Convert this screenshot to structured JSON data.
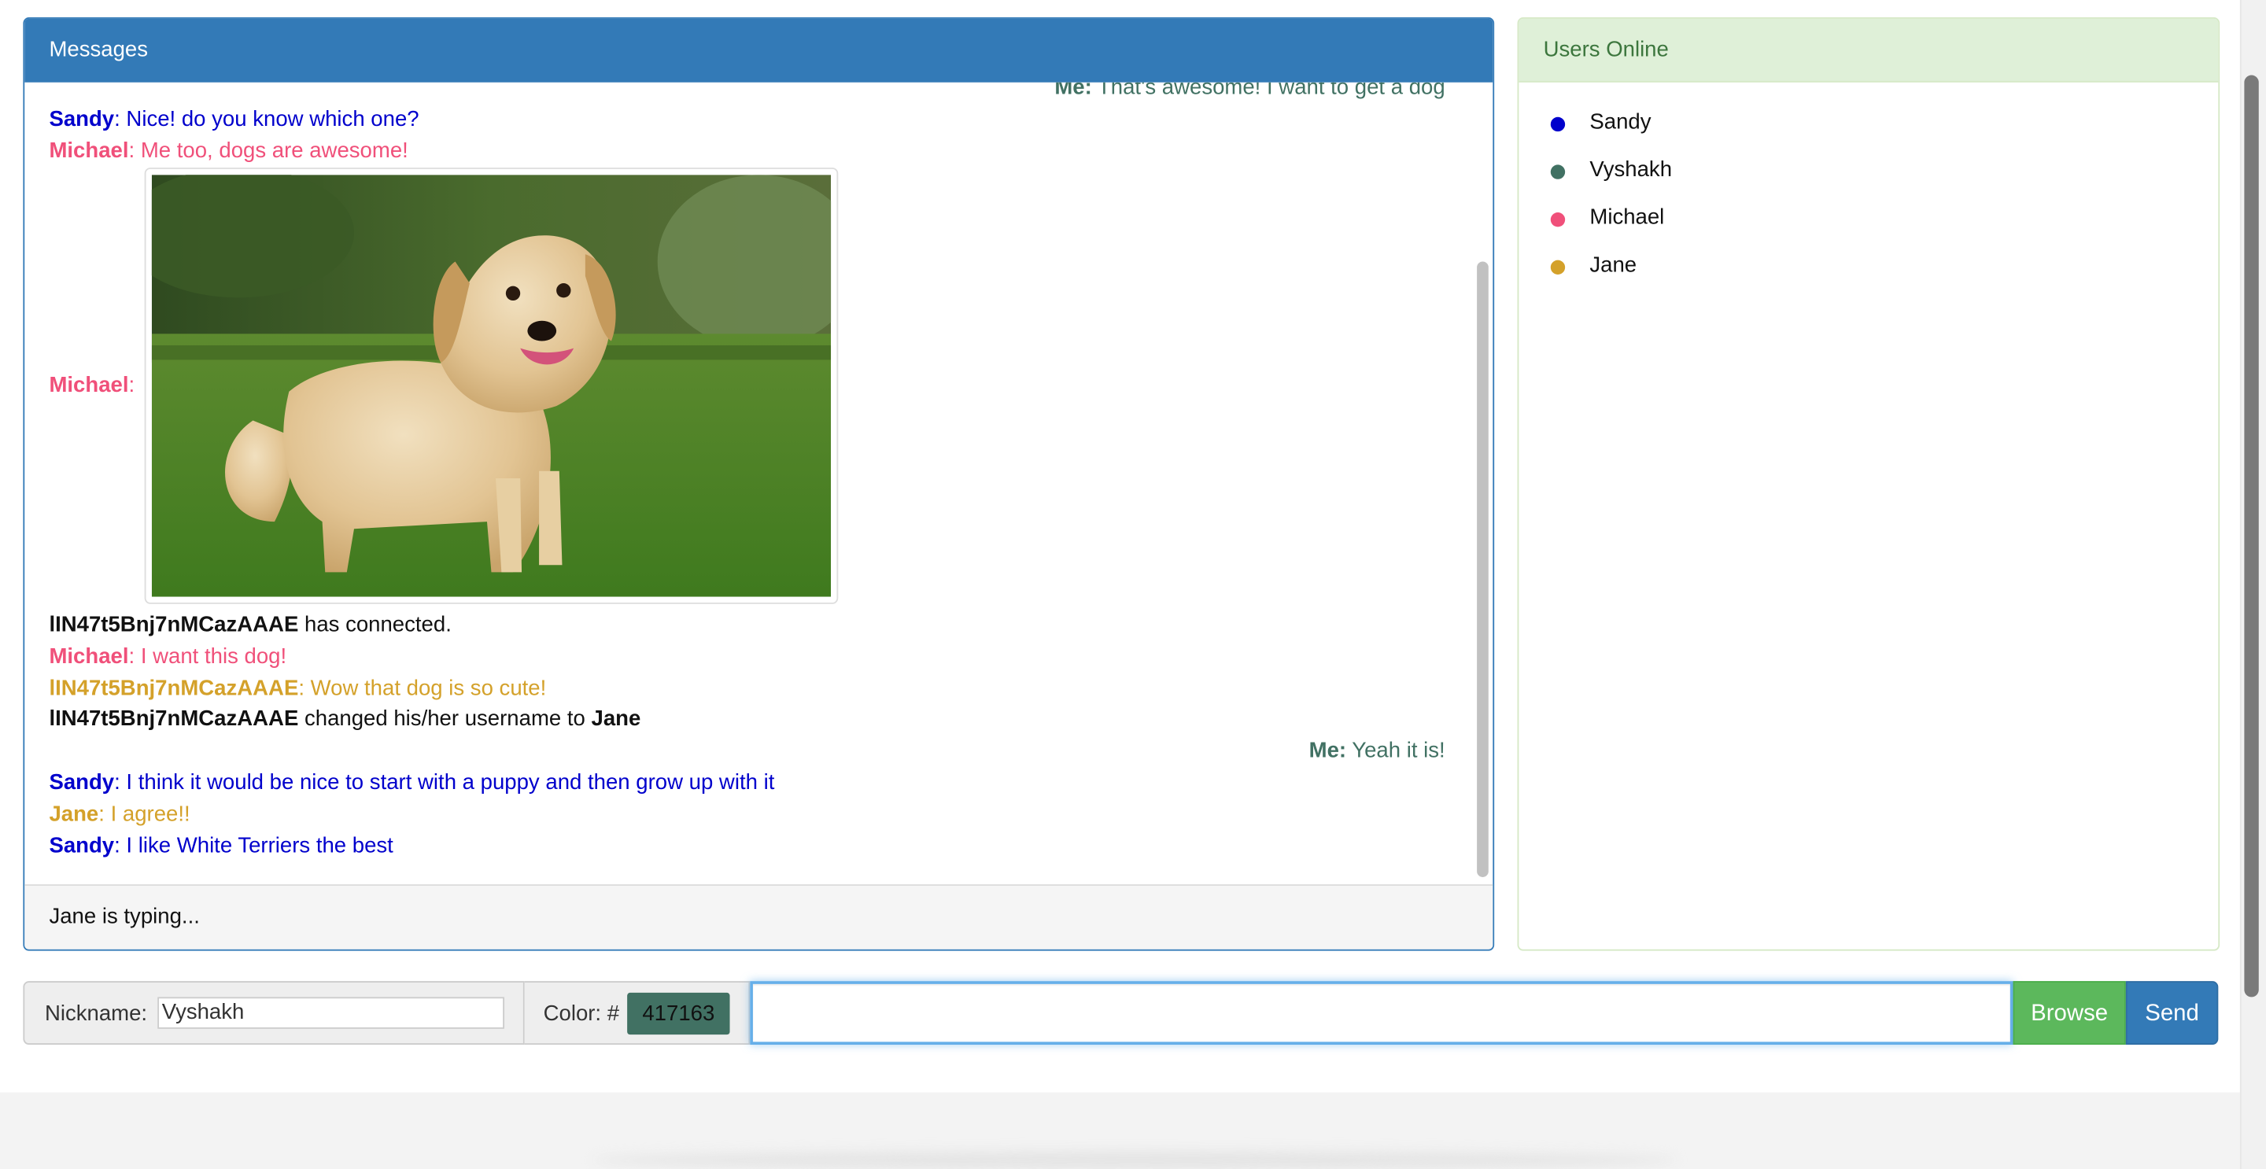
{
  "colors": {
    "sandy": "#0000cc",
    "vyshakh": "#417163",
    "michael": "#f0507a",
    "iln": "#d4a12a",
    "jane": "#d4a12a",
    "black": "#111111"
  },
  "messages_panel": {
    "title": "Messages",
    "lines": [
      {
        "user": "Me:",
        "text": " That's awesome! I want to get a dog"
      },
      {
        "user": "Sandy",
        "text": ": Nice! do you know which one?"
      },
      {
        "user": "Michael",
        "text": ": Me too, dogs are awesome!"
      },
      {
        "user": "Michael",
        "text": ":"
      },
      {
        "user": "lIN47t5Bnj7nMCazAAAE",
        "text": " has connected."
      },
      {
        "user": "Michael",
        "text": ": I want this dog!"
      },
      {
        "user": "lIN47t5Bnj7nMCazAAAE",
        "text": ": Wow that dog is so cute!"
      },
      {
        "user": "lIN47t5Bnj7nMCazAAAE",
        "text": " changed his/her username to ",
        "extra": "Jane"
      },
      {
        "user": "Me:",
        "text": " Yeah it is!"
      },
      {
        "user": "Sandy",
        "text": ": I think it would be nice to start with a puppy and then grow up with it"
      },
      {
        "user": "Jane",
        "text": ": I agree!!"
      },
      {
        "user": "Sandy",
        "text": ": I like White Terriers the best"
      }
    ],
    "typing": "Jane is typing..."
  },
  "users_panel": {
    "title": "Users Online",
    "users": [
      {
        "name": "Sandy",
        "color": "#0000cc"
      },
      {
        "name": "Vyshakh",
        "color": "#417163"
      },
      {
        "name": "Michael",
        "color": "#f0507a"
      },
      {
        "name": "Jane",
        "color": "#d4a12a"
      }
    ]
  },
  "controls": {
    "nickname_label": "Nickname:",
    "nickname_value": "Vyshakh",
    "color_label": "Color: #",
    "color_value": "417163",
    "message_placeholder": "",
    "browse_label": "Browse",
    "send_label": "Send"
  }
}
